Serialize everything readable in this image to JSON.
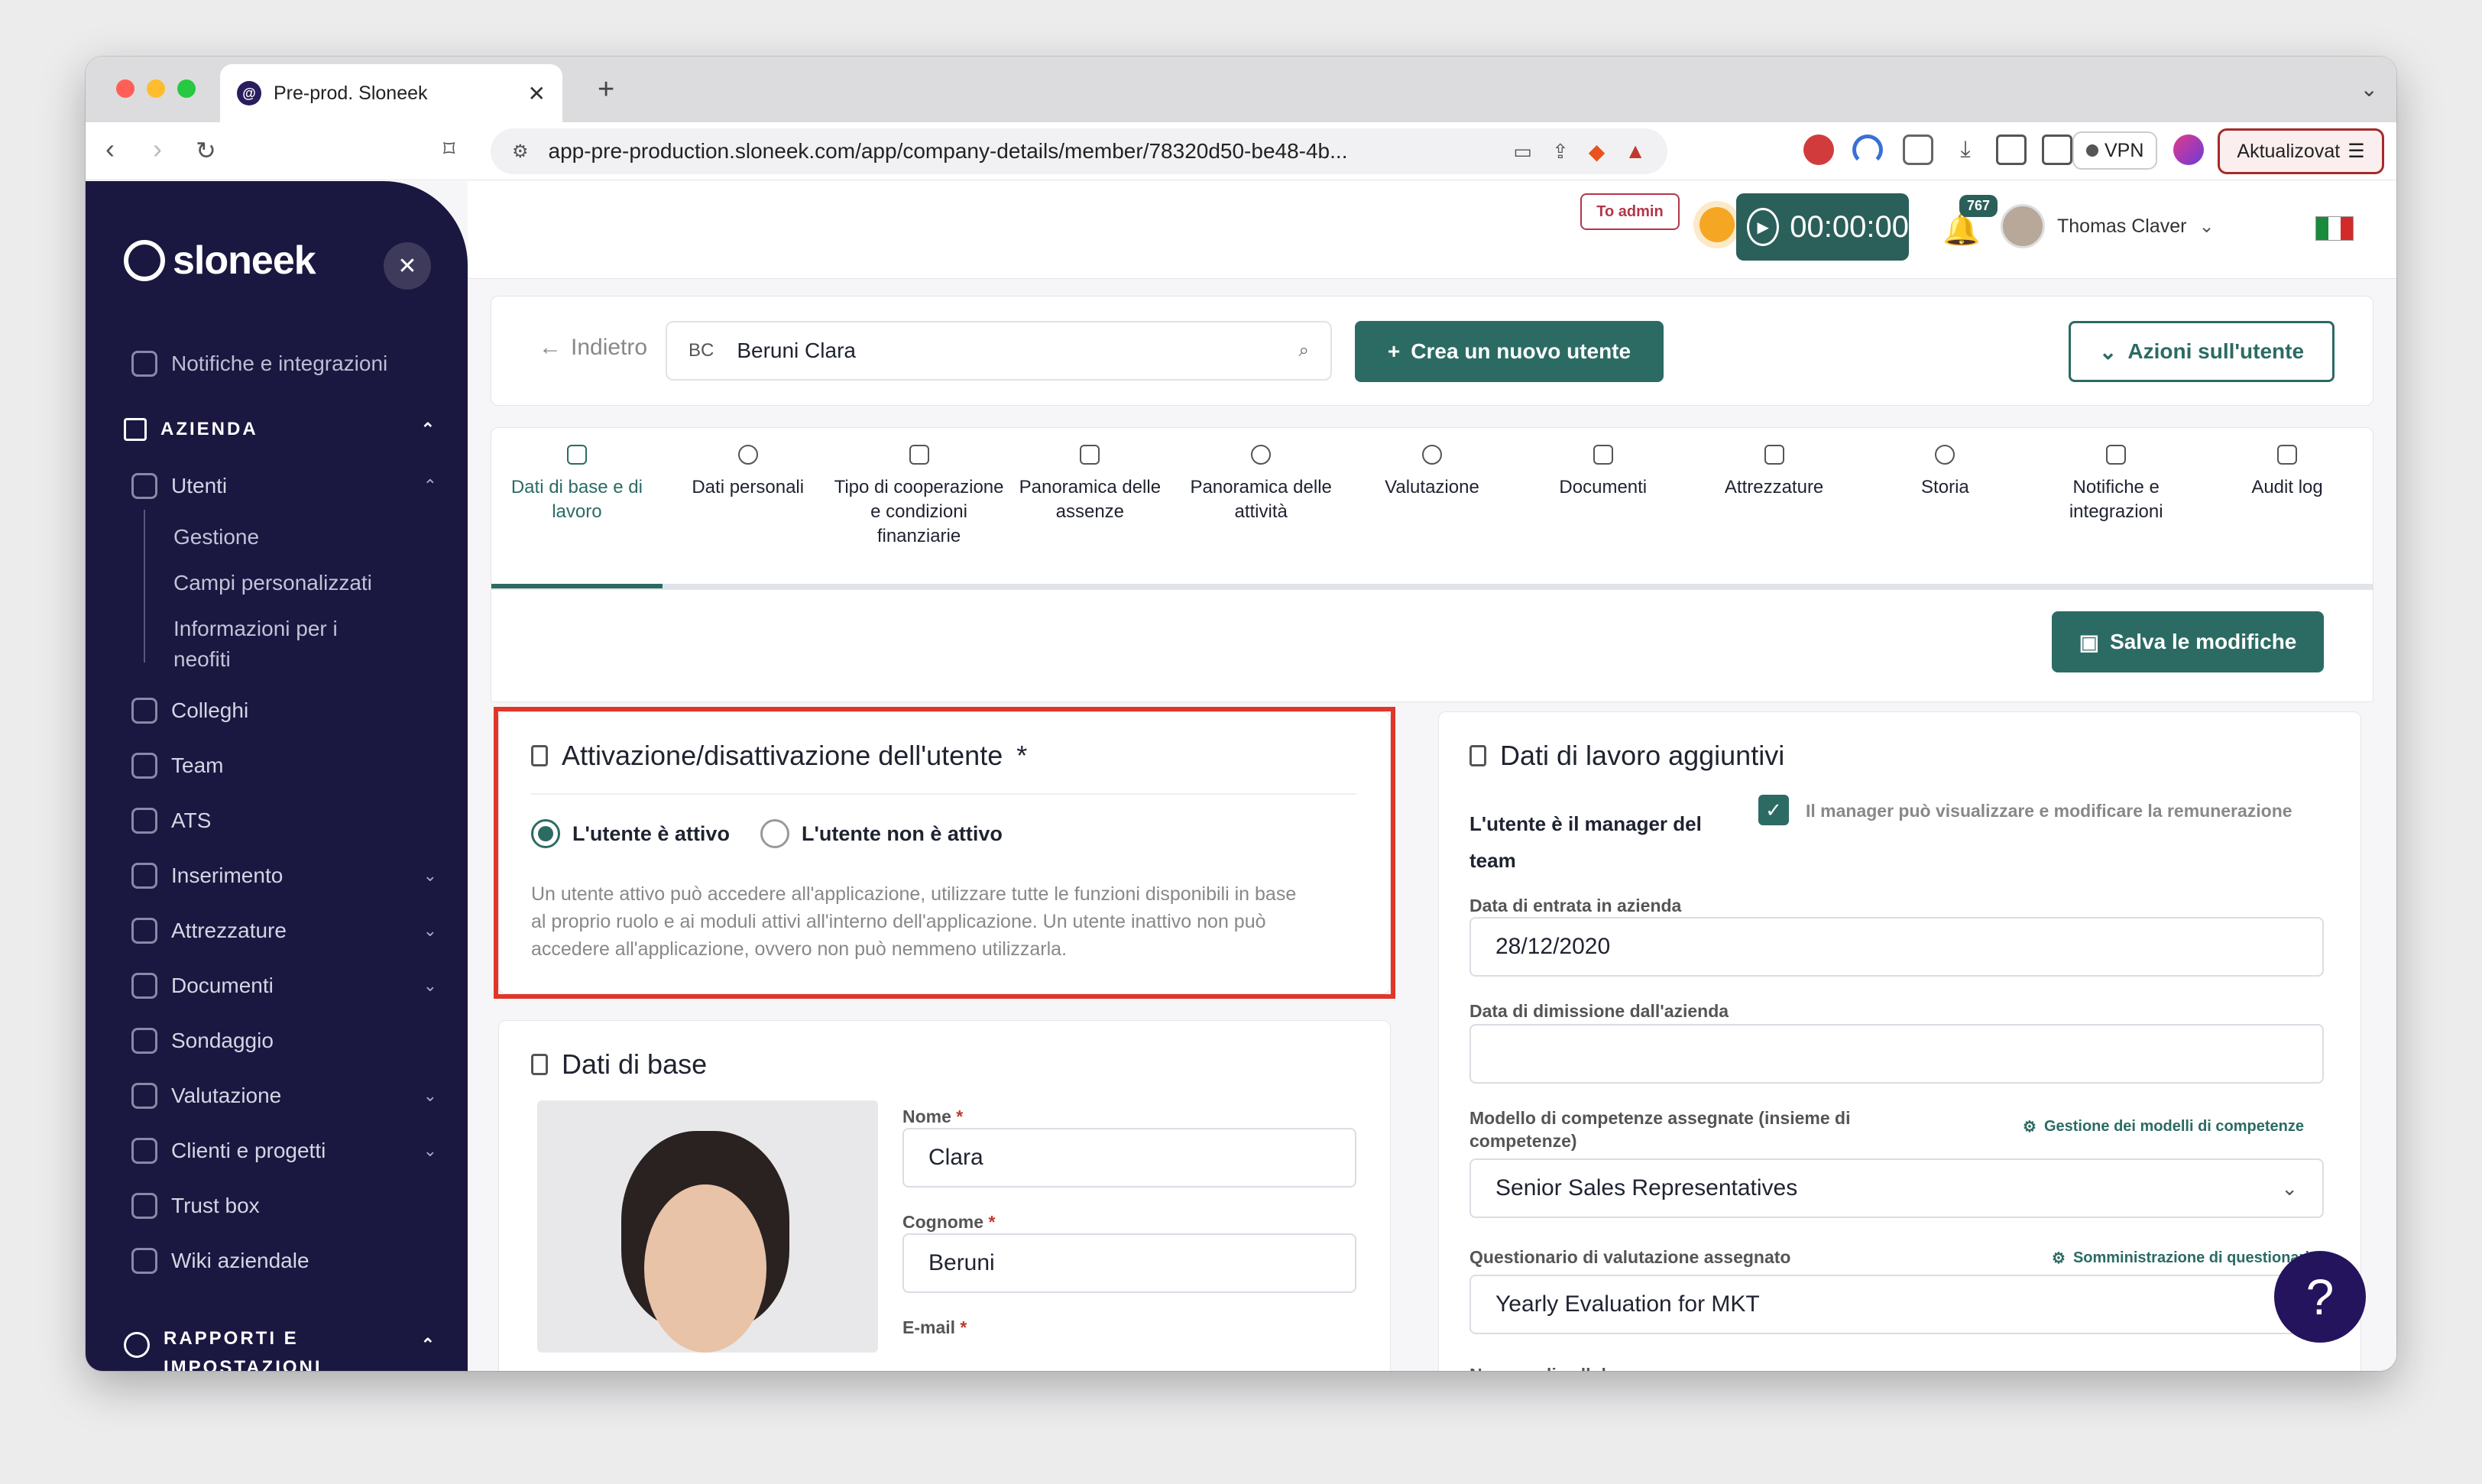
{
  "browser": {
    "tab_title": "Pre-prod. Sloneek",
    "url": "app-pre-production.sloneek.com/app/company-details/member/78320d50-be48-4b...",
    "vpn_label": "VPN",
    "update_label": "Aktualizovat"
  },
  "sidebar": {
    "logo": "sloneek",
    "top_item": "Notifiche e integrazioni",
    "section_company": "AZIENDA",
    "items": [
      {
        "label": "Utenti",
        "icon": "users-icon"
      },
      {
        "label": "Colleghi",
        "icon": "colleagues-icon"
      },
      {
        "label": "Team",
        "icon": "team-icon"
      },
      {
        "label": "ATS",
        "icon": "ats-icon"
      },
      {
        "label": "Inserimento",
        "icon": "onboarding-icon"
      },
      {
        "label": "Attrezzature",
        "icon": "tools-icon"
      },
      {
        "label": "Documenti",
        "icon": "folder-icon"
      },
      {
        "label": "Sondaggio",
        "icon": "poll-icon"
      },
      {
        "label": "Valutazione",
        "icon": "evaluation-icon"
      },
      {
        "label": "Clienti e progetti",
        "icon": "clients-icon"
      },
      {
        "label": "Trust box",
        "icon": "trust-icon"
      },
      {
        "label": "Wiki aziendale",
        "icon": "wiki-icon"
      }
    ],
    "sub_items": [
      "Gestione",
      "Campi personalizzati",
      "Informazioni per i",
      "neofiti"
    ],
    "section_reports_1": "RAPPORTI E",
    "section_reports_2": "IMPOSTAZIONI"
  },
  "header": {
    "to_admin": "To admin",
    "timer": "00:00:00",
    "notifications": "767",
    "user_name": "Thomas Claver"
  },
  "toolbar": {
    "back": "Indietro",
    "search_initials": "BC",
    "search_value": "Beruni Clara",
    "create_user": "Crea un nuovo utente",
    "user_actions": "Azioni sull'utente"
  },
  "tabs": [
    "Dati di base e di lavoro",
    "Dati personali",
    "Tipo di cooperazione e condizioni finanziarie",
    "Panoramica delle assenze",
    "Panoramica delle attività",
    "Valutazione",
    "Documenti",
    "Attrezzature",
    "Storia",
    "Notifiche e integrazioni",
    "Audit log"
  ],
  "save_button": "Salva le modifiche",
  "activation": {
    "title": "Attivazione/disattivazione dell'utente",
    "required": "*",
    "active_label": "L'utente è attivo",
    "inactive_label": "L'utente non è attivo",
    "help_1": "Un utente attivo può accedere all'applicazione, utilizzare tutte le funzioni disponibili in base",
    "help_2": "al proprio ruolo e ai moduli attivi all'interno dell'applicazione. Un utente inattivo non può",
    "help_3": "accedere all'applicazione, ovvero non può nemmeno utilizzarla."
  },
  "basic": {
    "title": "Dati di base",
    "first_name_label": "Nome",
    "first_name": "Clara",
    "last_name_label": "Cognome",
    "last_name": "Beruni",
    "email_label": "E-mail"
  },
  "work": {
    "title": "Dati di lavoro aggiuntivi",
    "manager_label_1": "L'utente è il manager del",
    "manager_label_2": "team",
    "manager_checkbox": "Il manager può visualizzare e modificare la remunerazione",
    "entry_label": "Data di entrata in azienda",
    "entry_date": "28/12/2020",
    "exit_label": "Data di dimissione dall'azienda",
    "exit_date": "",
    "competence_label_1": "Modello di competenze assegnate (insieme di",
    "competence_label_2": "competenze)",
    "competence_link": "Gestione dei modelli di competenze",
    "competence_value": "Senior Sales Representatives",
    "questionnaire_label": "Questionario di valutazione assegnato",
    "questionnaire_link": "Somministrazione di questionari",
    "questionnaire_value": "Yearly Evaluation for MKT",
    "phone_label": "Numero di cellulare"
  },
  "help_button": "?"
}
